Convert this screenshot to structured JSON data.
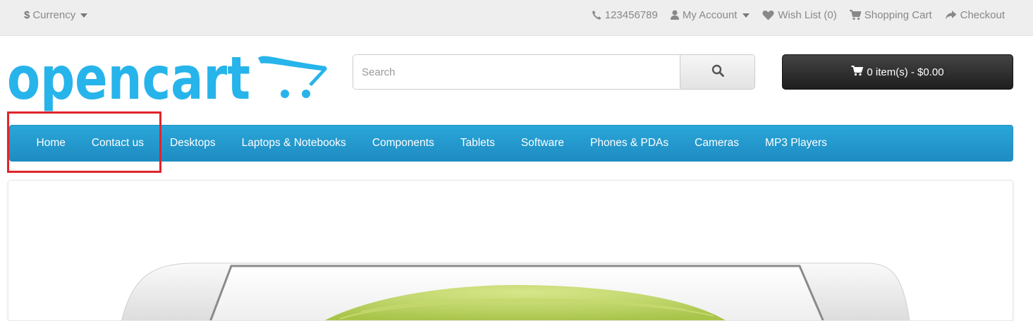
{
  "topbar": {
    "currency_symbol": "$",
    "currency_label": "Currency",
    "phone": "123456789",
    "my_account": "My Account",
    "wish_list": "Wish List (0)",
    "shopping_cart": "Shopping Cart",
    "checkout": "Checkout"
  },
  "logo": {
    "text": "opencart",
    "color": "#27b4ea"
  },
  "search": {
    "placeholder": "Search"
  },
  "cart": {
    "label": "0 item(s) - $0.00"
  },
  "menu": {
    "items": [
      {
        "label": "Home"
      },
      {
        "label": "Contact us"
      },
      {
        "label": "Desktops"
      },
      {
        "label": "Laptops & Notebooks"
      },
      {
        "label": "Components"
      },
      {
        "label": "Tablets"
      },
      {
        "label": "Software"
      },
      {
        "label": "Phones & PDAs"
      },
      {
        "label": "Cameras"
      },
      {
        "label": "MP3 Players"
      }
    ],
    "highlight_color": "#e0242c"
  },
  "icons": {
    "currency_caret": "chevron-down-icon",
    "phone": "phone-icon",
    "account": "user-icon",
    "wishlist": "heart-icon",
    "cart": "cart-icon",
    "checkout": "share-icon",
    "search": "search-icon"
  }
}
